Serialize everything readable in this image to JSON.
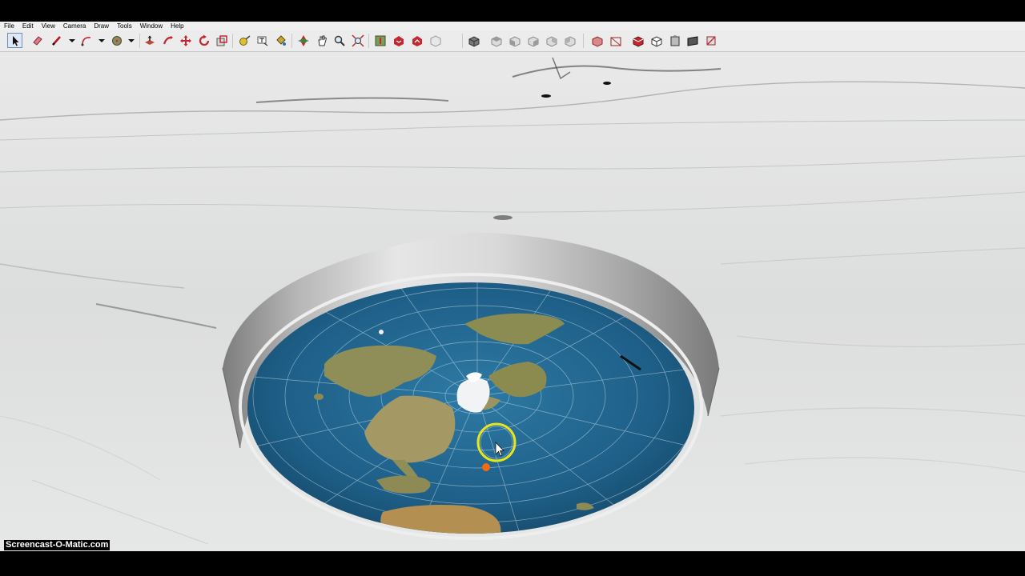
{
  "menu": [
    "File",
    "Edit",
    "View",
    "Camera",
    "Draw",
    "Tools",
    "Window",
    "Help"
  ],
  "toolbar": {
    "tools": [
      {
        "name": "select-tool-icon"
      },
      {
        "name": "eraser-tool-icon"
      },
      {
        "name": "line-tool-icon"
      },
      {
        "name": "arc-tool-icon"
      },
      {
        "name": "shape-tool-icon"
      },
      {
        "name": "push-pull-tool-icon"
      },
      {
        "name": "follow-me-tool-icon"
      },
      {
        "name": "move-tool-icon"
      },
      {
        "name": "rotate-tool-icon"
      },
      {
        "name": "scale-tool-icon"
      },
      {
        "name": "tape-measure-tool-icon"
      },
      {
        "name": "text-tool-icon"
      },
      {
        "name": "paint-bucket-tool-icon"
      },
      {
        "name": "orbit-tool-icon"
      },
      {
        "name": "pan-tool-icon"
      },
      {
        "name": "zoom-tool-icon"
      },
      {
        "name": "zoom-extents-tool-icon"
      },
      {
        "name": "add-location-icon"
      },
      {
        "name": "get-models-icon"
      },
      {
        "name": "share-model-icon"
      },
      {
        "name": "component-icon"
      },
      {
        "name": "iso-view-icon"
      },
      {
        "name": "top-view-icon"
      },
      {
        "name": "front-view-icon"
      },
      {
        "name": "right-view-icon"
      },
      {
        "name": "back-view-icon"
      },
      {
        "name": "left-view-icon"
      },
      {
        "name": "xray-style-icon"
      },
      {
        "name": "wireframe-style-icon"
      },
      {
        "name": "hidden-line-style-icon"
      },
      {
        "name": "shaded-style-icon"
      },
      {
        "name": "textured-style-icon"
      },
      {
        "name": "monochrome-style-icon"
      }
    ]
  },
  "watermark": "Screencast-O-Matic.com",
  "colors": {
    "ocean": "#1f5f86",
    "land": "#8a8f4c",
    "wall": "#c9c9c9",
    "snow": "#e4e4e4",
    "cursor_ring": "#e8e61a",
    "marker": "#f26a12"
  }
}
